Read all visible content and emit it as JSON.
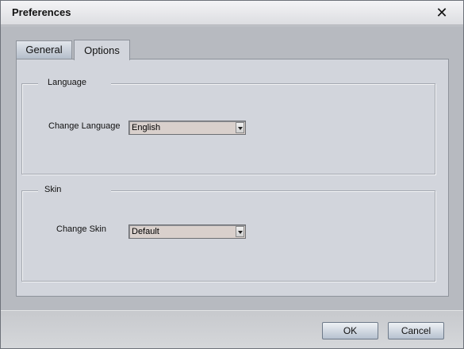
{
  "window": {
    "title": "Preferences",
    "close_glyph": "✕"
  },
  "tabs": [
    {
      "label": "General",
      "active": false
    },
    {
      "label": "Options",
      "active": true
    }
  ],
  "language_group": {
    "legend": "Language",
    "field_label": "Change Language",
    "selected": "English"
  },
  "skin_group": {
    "legend": "Skin",
    "field_label": "Change Skin",
    "selected": "Default"
  },
  "footer": {
    "ok_label": "OK",
    "cancel_label": "Cancel"
  },
  "icons": {
    "close": "close-icon",
    "dropdown": "chevron-down-icon"
  }
}
